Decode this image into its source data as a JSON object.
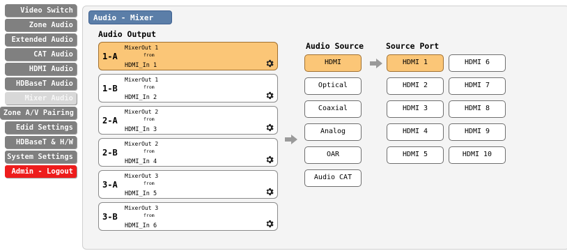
{
  "sidebar": {
    "items": [
      {
        "label": "Video Switch"
      },
      {
        "label": "Zone Audio"
      },
      {
        "label": "Extended Audio"
      },
      {
        "label": "CAT Audio"
      },
      {
        "label": "HDMI Audio"
      },
      {
        "label": "HDBaseT Audio"
      },
      {
        "label": "Mixer Audio"
      },
      {
        "label": "Zone A/V Pairing"
      },
      {
        "label": "Edid Settings"
      },
      {
        "label": "HDBaseT & H/W"
      },
      {
        "label": "System Settings"
      },
      {
        "label": "Admin - Logout"
      }
    ]
  },
  "panel": {
    "title": "Audio - Mixer",
    "audio_output_label": "Audio Output",
    "audio_source_label": "Audio Source",
    "source_port_label": "Source Port"
  },
  "outputs": [
    {
      "id": "1-A",
      "mixer": "MixerOut 1",
      "from": "from",
      "source": "HDMI_In 1",
      "selected": true
    },
    {
      "id": "1-B",
      "mixer": "MixerOut 1",
      "from": "from",
      "source": "HDMI_In 2",
      "selected": false
    },
    {
      "id": "2-A",
      "mixer": "MixerOut 2",
      "from": "from",
      "source": "HDMI_In 3",
      "selected": false
    },
    {
      "id": "2-B",
      "mixer": "MixerOut 2",
      "from": "from",
      "source": "HDMI_In 4",
      "selected": false
    },
    {
      "id": "3-A",
      "mixer": "MixerOut 3",
      "from": "from",
      "source": "HDMI_In 5",
      "selected": false
    },
    {
      "id": "3-B",
      "mixer": "MixerOut 3",
      "from": "from",
      "source": "HDMI_In 6",
      "selected": false
    }
  ],
  "audio_sources": [
    {
      "label": "HDMI",
      "selected": true
    },
    {
      "label": "Optical",
      "selected": false
    },
    {
      "label": "Coaxial",
      "selected": false
    },
    {
      "label": "Analog",
      "selected": false
    },
    {
      "label": "OAR",
      "selected": false
    },
    {
      "label": "Audio CAT",
      "selected": false
    }
  ],
  "source_ports": [
    {
      "label": "HDMI 1",
      "selected": true
    },
    {
      "label": "HDMI 2",
      "selected": false
    },
    {
      "label": "HDMI 3",
      "selected": false
    },
    {
      "label": "HDMI 4",
      "selected": false
    },
    {
      "label": "HDMI 5",
      "selected": false
    },
    {
      "label": "HDMI 6",
      "selected": false
    },
    {
      "label": "HDMI 7",
      "selected": false
    },
    {
      "label": "HDMI 8",
      "selected": false
    },
    {
      "label": "HDMI 9",
      "selected": false
    },
    {
      "label": "HDMI 10",
      "selected": false
    }
  ],
  "colors": {
    "selected": "#fbc677",
    "nav": "#808080",
    "nav_active": "#d8d8d8",
    "logout": "#ee1c1c",
    "title_bar": "#5b7ea8"
  },
  "icons": {
    "gear": "gear-icon",
    "arrow": "arrow-right-icon"
  }
}
